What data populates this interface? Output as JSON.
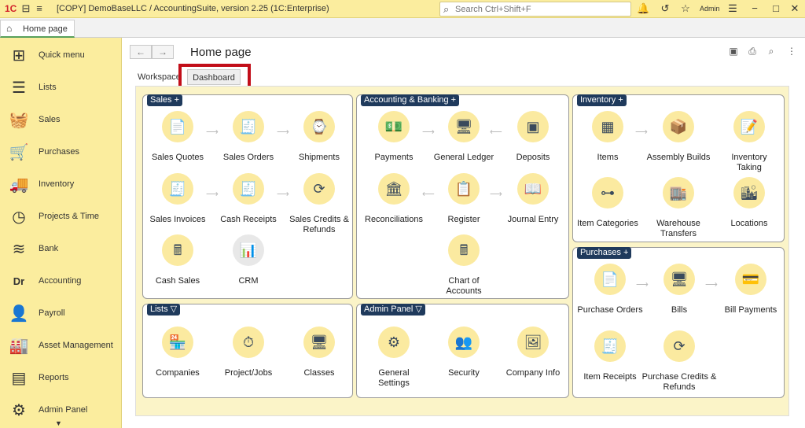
{
  "titlebar": {
    "logo": "1C",
    "title": "[COPY] DemoBaseLLC / AccountingSuite, version 2.25  (1C:Enterprise)",
    "search_placeholder": "Search Ctrl+Shift+F",
    "user": "Admin"
  },
  "tabs": {
    "home": "Home page"
  },
  "sidebar": {
    "items": [
      {
        "label": "Quick menu",
        "icon": "quick-menu-icon",
        "glyph": "⊞"
      },
      {
        "label": "Lists",
        "icon": "lists-icon",
        "glyph": "☰"
      },
      {
        "label": "Sales",
        "icon": "basket-icon",
        "glyph": "🧺"
      },
      {
        "label": "Purchases",
        "icon": "cart-icon",
        "glyph": "🛒"
      },
      {
        "label": "Inventory",
        "icon": "truck-icon",
        "glyph": "🚚"
      },
      {
        "label": "Projects & Time",
        "icon": "clock-icon",
        "glyph": "◷"
      },
      {
        "label": "Bank",
        "icon": "coins-icon",
        "glyph": "≋"
      },
      {
        "label": "Accounting",
        "icon": "drcr-icon",
        "glyph": "Dr"
      },
      {
        "label": "Payroll",
        "icon": "person-icon",
        "glyph": "👤"
      },
      {
        "label": "Asset Management",
        "icon": "asset-icon",
        "glyph": "🏭"
      },
      {
        "label": "Reports",
        "icon": "report-icon",
        "glyph": "▤"
      },
      {
        "label": "Admin Panel",
        "icon": "gear-icon",
        "glyph": "⚙"
      }
    ]
  },
  "main": {
    "title": "Home page",
    "tab_workspace": "Workspace",
    "tab_dashboard": "Dashboard",
    "panels": {
      "sales": {
        "title": "Sales +",
        "items": [
          "Sales Quotes",
          "Sales Orders",
          "Shipments",
          "Sales Invoices",
          "Cash Receipts",
          "Sales Credits & Refunds",
          "Cash Sales",
          "CRM"
        ]
      },
      "accounting": {
        "title": "Accounting & Banking +",
        "items": [
          "Payments",
          "General Ledger",
          "Deposits",
          "Reconciliations",
          "Register",
          "Journal Entry",
          "Chart of Accounts"
        ]
      },
      "inventory": {
        "title": "Inventory +",
        "items": [
          "Items",
          "Assembly Builds",
          "Inventory Taking",
          "Item Categories",
          "Warehouse Transfers",
          "Locations"
        ]
      },
      "purchases": {
        "title": "Purchases +",
        "items": [
          "Purchase Orders",
          "Bills",
          "Bill Payments",
          "Item Receipts",
          "Purchase Credits & Refunds"
        ]
      },
      "lists": {
        "title": "Lists ▽",
        "items": [
          "Companies",
          "Project/Jobs",
          "Classes"
        ]
      },
      "admin": {
        "title": "Admin Panel ▽",
        "items": [
          "General Settings",
          "Security",
          "Company Info"
        ]
      }
    }
  }
}
